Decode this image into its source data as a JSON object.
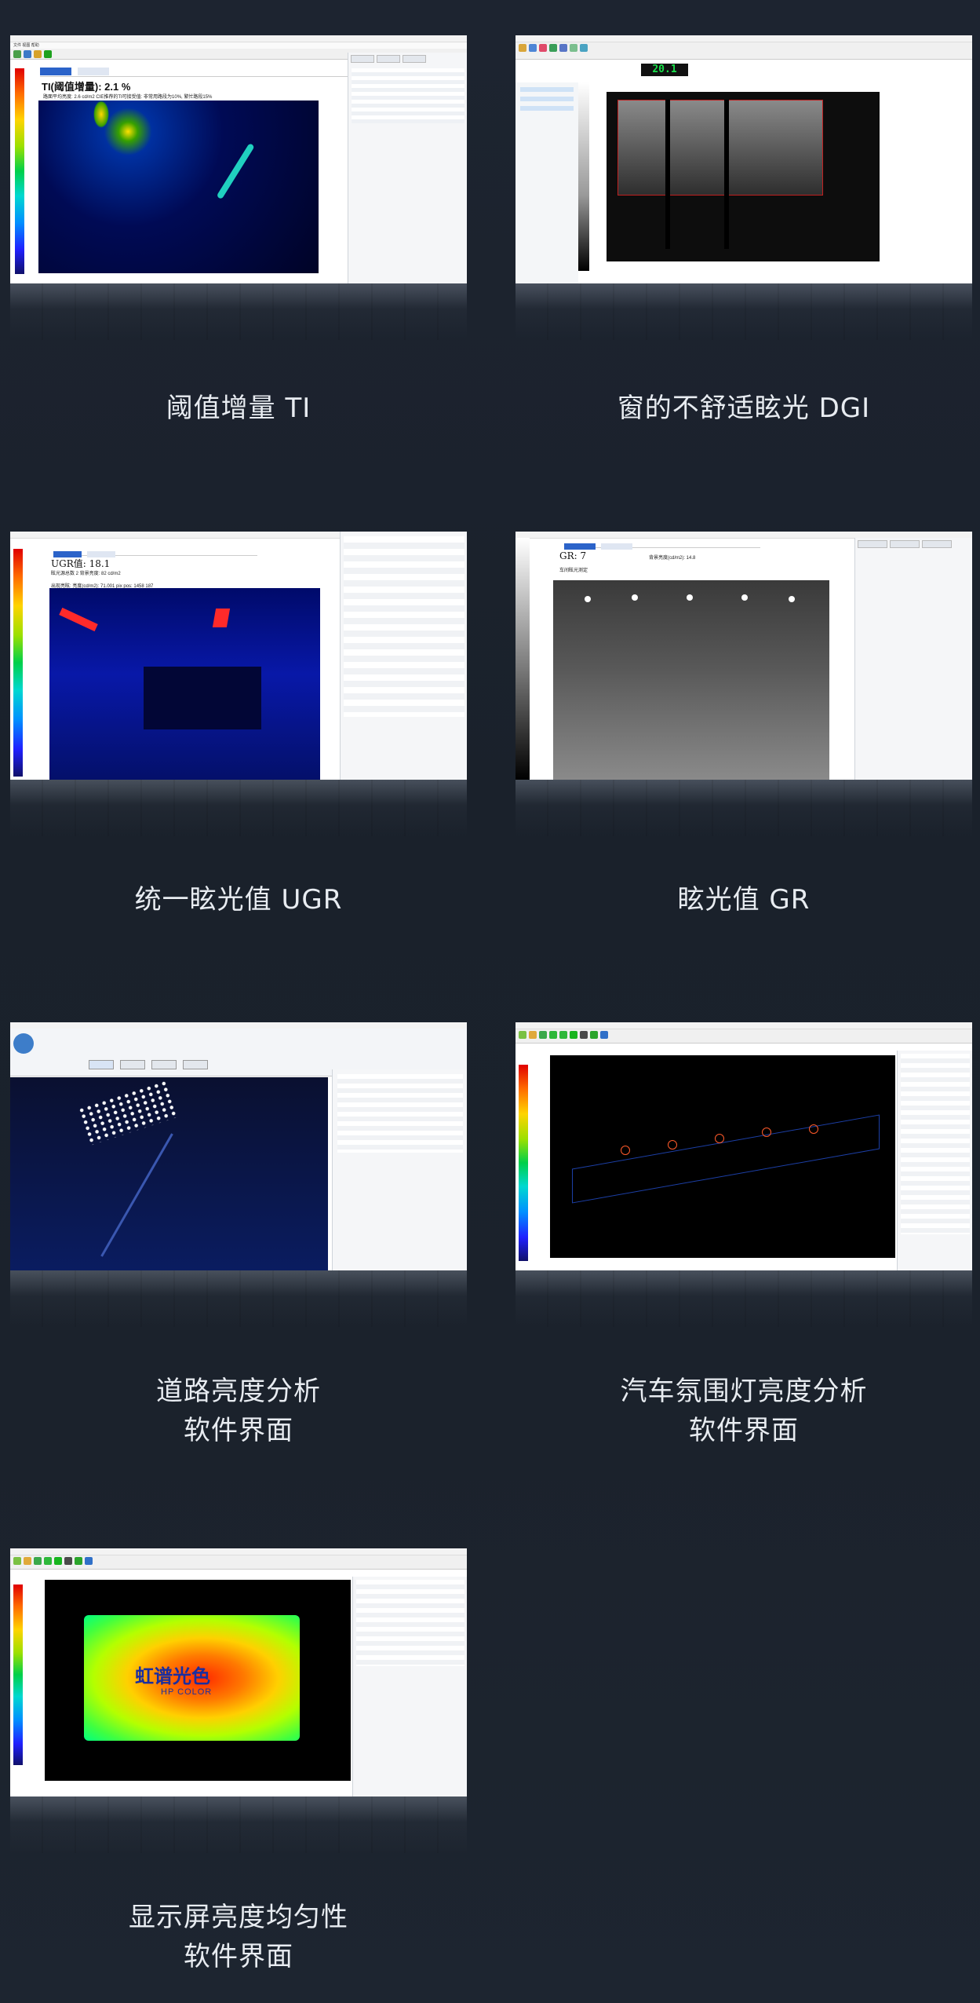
{
  "cards": [
    {
      "caption_line1": "阈值增量 TI",
      "caption_line2": "",
      "screen_heading": "TI(阈值增量):  2.1 %",
      "screen_subheading": "路面平均亮度: 2.6 cd/m2  CIE推荐的TI可接受值: 非常用路段为10%, 繁忙路段15%"
    },
    {
      "caption_line1": "窗的不舒适眩光 DGI",
      "caption_line2": "",
      "screen_value": "20.1"
    },
    {
      "caption_line1": "统一眩光值 UGR",
      "caption_line2": "",
      "screen_heading": "UGR值:  18.1",
      "screen_sub1": "眩光源总数  2     背景亮度: 82 cd/m2",
      "screen_sub2": "出现亮眩:  亮度(cd/m2):  71.001   pix pos: 1458 187"
    },
    {
      "caption_line1": "眩光值 GR",
      "caption_line2": "",
      "screen_heading": "GR: 7",
      "screen_sub1": "背景亮度(cd/m2):  14.8",
      "screen_sub2": "车间眩光测定"
    },
    {
      "caption_line1": "道路亮度分析",
      "caption_line2": "软件界面"
    },
    {
      "caption_line1": "汽车氛围灯亮度分析",
      "caption_line2": "软件界面"
    },
    {
      "caption_line1": "显示屏亮度均匀性",
      "caption_line2": "软件界面",
      "logo_text": "虹谱光色",
      "logo_subtext": "HP COLOR"
    }
  ],
  "colors": {
    "background": "#1c232d",
    "caption": "#e8ecf1"
  },
  "icons": [
    "colorbar-scale",
    "toolbar-icons"
  ]
}
